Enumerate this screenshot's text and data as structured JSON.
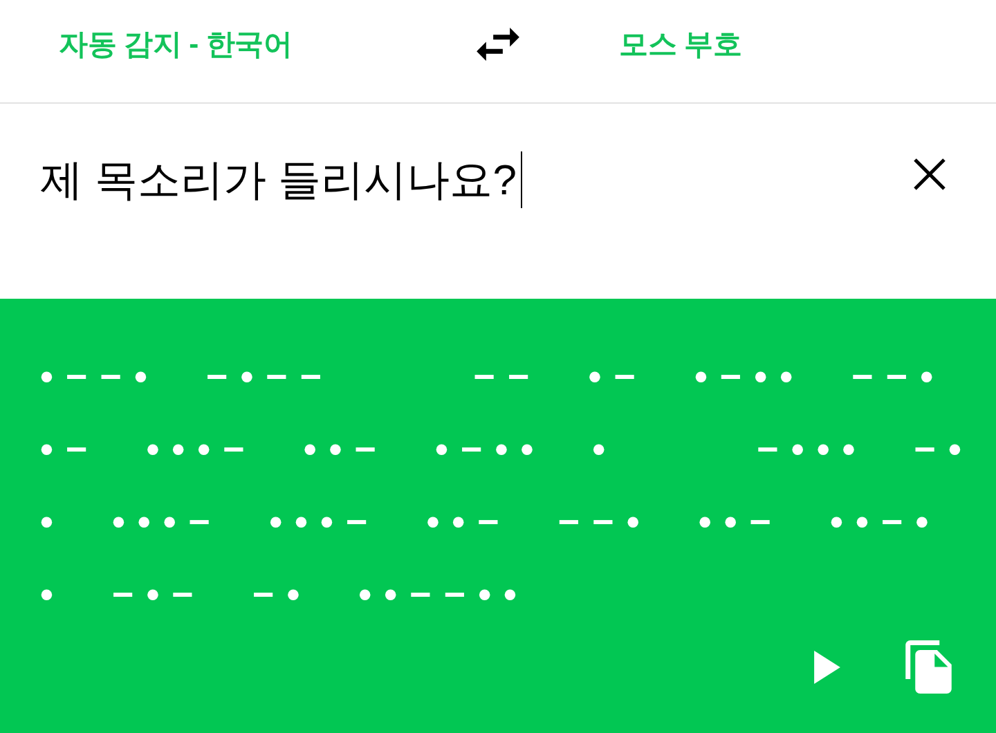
{
  "language_bar": {
    "source_language": "자동 감지 - 한국어",
    "target_language": "모스 부호"
  },
  "source": {
    "value": "제 목소리가 들리시나요?",
    "focused": true
  },
  "output": {
    "lines": [
      "•−−• −•−−   −− •− •−•• −−•",
      "•− •••− ••− •−•• •   −••• −•",
      "• •••− •••− ••− −−• ••− ••−•",
      "• −•− −• ••−−••"
    ]
  }
}
